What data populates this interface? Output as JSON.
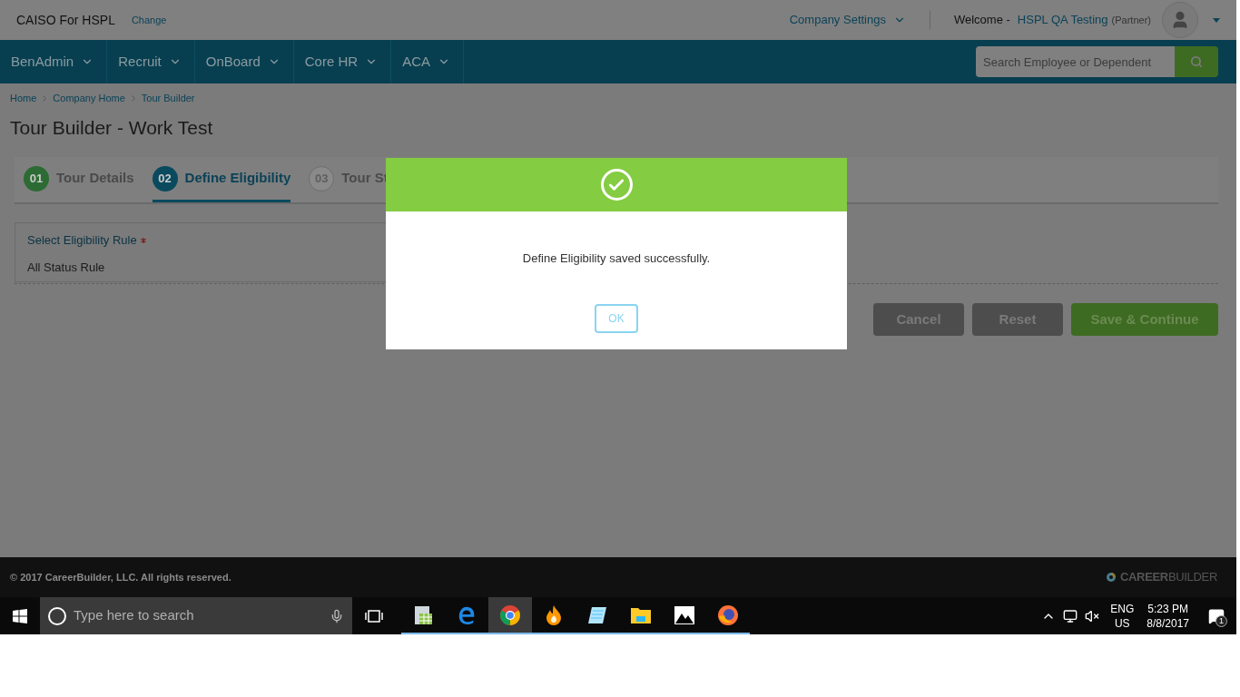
{
  "header": {
    "company": "CAISO For HSPL",
    "change_link": "Change",
    "settings": "Company Settings",
    "welcome": "Welcome -",
    "user": "HSPL QA Testing",
    "role": "(Partner)"
  },
  "nav": {
    "items": [
      "BenAdmin",
      "Recruit",
      "OnBoard",
      "Core HR",
      "ACA"
    ],
    "search": {
      "placeholder": "Search Employee or Dependent"
    }
  },
  "breadcrumbs": [
    "Home",
    "Company Home",
    "Tour Builder"
  ],
  "page_title": "Tour Builder - Work Test",
  "steps": [
    {
      "number": "01",
      "label": "Tour Details",
      "kind": "done",
      "selected": false
    },
    {
      "number": "02",
      "label": "Define Eligibility",
      "kind": "current",
      "selected": true
    },
    {
      "number": "03",
      "label": "Tour St",
      "kind": "pending",
      "selected": false
    }
  ],
  "form": {
    "label": "Select Eligibility Rule",
    "required": true,
    "value": "All Status Rule"
  },
  "buttons": [
    {
      "label": "Cancel",
      "kind": "secondary"
    },
    {
      "label": "Reset",
      "kind": "secondary"
    },
    {
      "label": "Save & Continue",
      "kind": "primary"
    }
  ],
  "modal": {
    "message": "Define Eligibility saved successfully.",
    "ok": "OK"
  },
  "footer": {
    "copyright": "© 2017 CareerBuilder, LLC. All rights reserved.",
    "brand": "**CAREER**BUILDER"
  },
  "taskbar": {
    "search": {
      "placeholder": "Type here to search"
    },
    "apps": [
      {
        "kind": "sheet",
        "selected": false
      },
      {
        "kind": "edge",
        "selected": false
      },
      {
        "kind": "chrome",
        "selected": true
      },
      {
        "kind": "flame",
        "selected": false
      },
      {
        "kind": "notepad",
        "selected": false
      },
      {
        "kind": "folder",
        "selected": false
      },
      {
        "kind": "photos",
        "selected": false
      },
      {
        "kind": "firefox",
        "selected": false
      }
    ],
    "language": "ENG",
    "region": "US",
    "time": "5:23 PM",
    "date": "8/8/2017",
    "notifications": "1"
  }
}
